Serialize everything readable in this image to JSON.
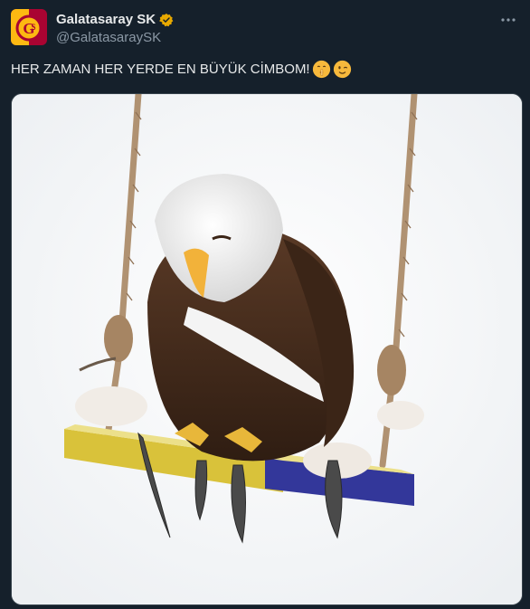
{
  "account": {
    "display_name": "Galatasaray SK",
    "handle": "@GalatasaraySK",
    "verified": true,
    "brand_colors": {
      "red": "#a90432",
      "yellow": "#fdb912"
    }
  },
  "icons": {
    "avatar": "galatasaray-logo",
    "verified": "verified-badge-icon",
    "more": "more-options-icon"
  },
  "tweet": {
    "text": "HER ZAMAN HER YERDE EN BÜYÜK CİMBOM!",
    "emojis": [
      "shushing-face-emoji",
      "winking-face-emoji"
    ]
  },
  "media": {
    "subject": "eagle-on-swing-image"
  },
  "theme": {
    "background": "#15202b",
    "text": "#e7e9ea",
    "secondary_text": "#8b98a5",
    "verified_color": "#e8a900",
    "swing_yellow": "#d9c23a",
    "swing_blue": "#33379a"
  }
}
